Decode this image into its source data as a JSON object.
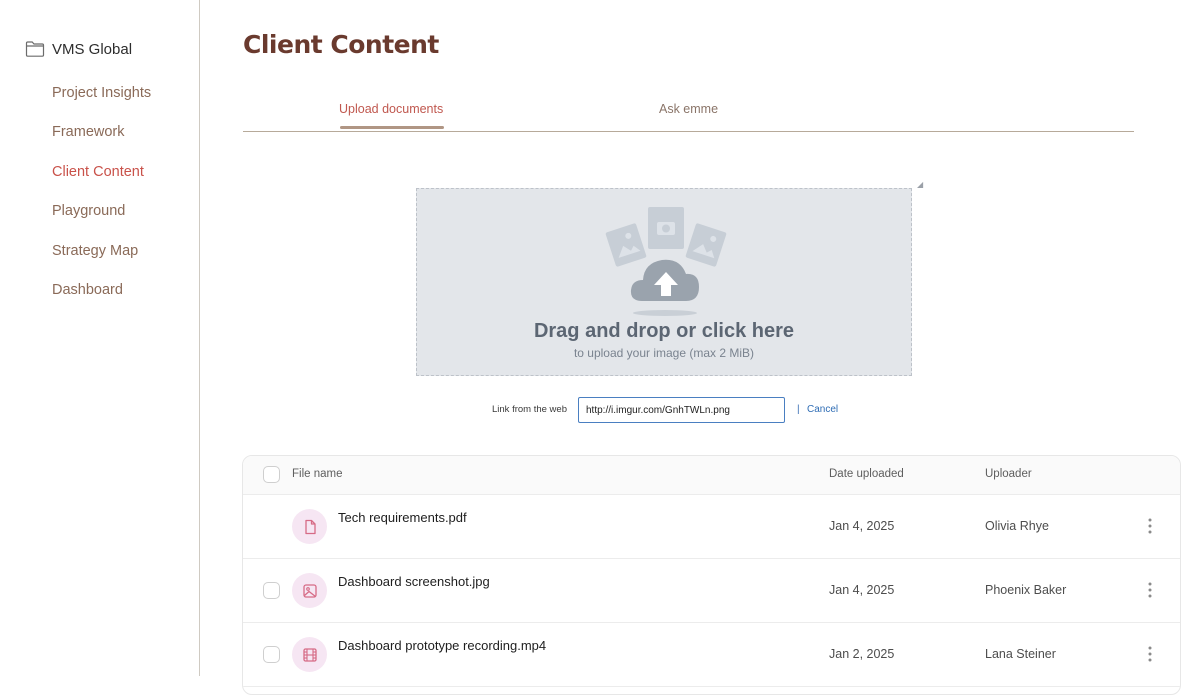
{
  "sidebar": {
    "workspace": "VMS Global",
    "items": [
      {
        "label": "Project Insights",
        "active": false
      },
      {
        "label": "Framework",
        "active": false
      },
      {
        "label": "Client Content",
        "active": true
      },
      {
        "label": "Playground",
        "active": false
      },
      {
        "label": "Strategy Map",
        "active": false
      },
      {
        "label": "Dashboard",
        "active": false
      }
    ]
  },
  "main": {
    "title": "Client Content",
    "tabs": [
      {
        "label": "Upload documents",
        "active": true
      },
      {
        "label": "Ask emme",
        "active": false
      }
    ]
  },
  "dropzone": {
    "title": "Drag and drop or click here",
    "subtitle": "to upload your image (max 2 MiB)"
  },
  "link_from_web": {
    "label": "Link from the web",
    "value": "http://i.imgur.com/GnhTWLn.png",
    "separator": "|",
    "cancel": "Cancel"
  },
  "table": {
    "headers": {
      "file_name": "File name",
      "date": "Date uploaded",
      "uploader": "Uploader"
    },
    "rows": [
      {
        "file_name": "Tech requirements.pdf",
        "date": "Jan 4, 2025",
        "uploader": "Olivia Rhye",
        "icon": "document-icon"
      },
      {
        "file_name": "Dashboard screenshot.jpg",
        "date": "Jan 4, 2025",
        "uploader": "Phoenix Baker",
        "icon": "image-icon"
      },
      {
        "file_name": "Dashboard prototype recording.mp4",
        "date": "Jan 2, 2025",
        "uploader": "Lana Steiner",
        "icon": "film-icon"
      }
    ]
  },
  "colors": {
    "title": "#6a3a2e",
    "nav_text": "#8a6a58",
    "active": "#c9524a",
    "dropzone_bg": "#e3e6ea",
    "file_icon_bg": "#f6e6f3",
    "file_icon_stroke": "#d66b86",
    "link": "#2f6db5"
  }
}
